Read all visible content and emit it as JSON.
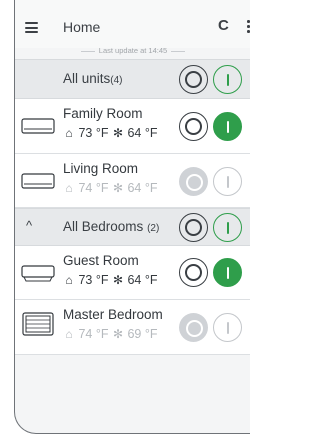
{
  "header": {
    "title": "Home",
    "refresh_icon": "C"
  },
  "last_update": "Last update at 14:45",
  "units_group": {
    "label": "All units",
    "count": "(4)"
  },
  "rooms_top": [
    {
      "name": "Family Room",
      "indoor_temp": "73 °F",
      "set_temp": "64 °F",
      "power": "on",
      "unit_style": "wall-split"
    },
    {
      "name": "Living Room",
      "indoor_temp": "74 °F",
      "set_temp": "64 °F",
      "power": "off",
      "unit_style": "wall-split"
    }
  ],
  "bedrooms_group": {
    "label": "All Bedrooms",
    "count": "(2)",
    "expand_icon": "^"
  },
  "rooms_bedrooms": [
    {
      "name": "Guest Room",
      "indoor_temp": "73 °F",
      "set_temp": "64 °F",
      "power": "on",
      "unit_style": "wall-split-open"
    },
    {
      "name": "Master Bedroom",
      "indoor_temp": "74 °F",
      "set_temp": "69 °F",
      "power": "off",
      "unit_style": "floor-cassette"
    }
  ],
  "icons": {
    "indoor": "house-thermometer-icon",
    "setpoint": "snowflake-icon"
  },
  "colors": {
    "on_green": "#2f9e4b",
    "off_grey": "#cfd2d6"
  }
}
